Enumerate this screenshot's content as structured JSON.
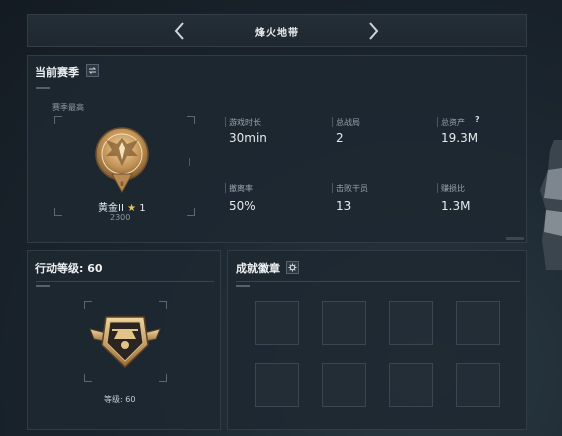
{
  "header": {
    "title": "烽火地带"
  },
  "season": {
    "title": "当前赛季",
    "best_label": "赛季最高",
    "rank_name": "黄金II",
    "rank_stars": "1",
    "rank_score": "2300",
    "stats": [
      {
        "label": "游戏时长",
        "value": "30min"
      },
      {
        "label": "总战局",
        "value": "2"
      },
      {
        "label": "总资产",
        "value": "19.3M",
        "help": "?"
      },
      {
        "label": "撤离率",
        "value": "50%"
      },
      {
        "label": "击败干员",
        "value": "13"
      },
      {
        "label": "赚损比",
        "value": "1.3M"
      }
    ]
  },
  "action_level": {
    "title": "行动等级: 60",
    "level_text": "等级: 60"
  },
  "achievements": {
    "title": "成就徽章"
  },
  "colors": {
    "accent_gold": "#c9a062",
    "star": "#e8c15a"
  }
}
